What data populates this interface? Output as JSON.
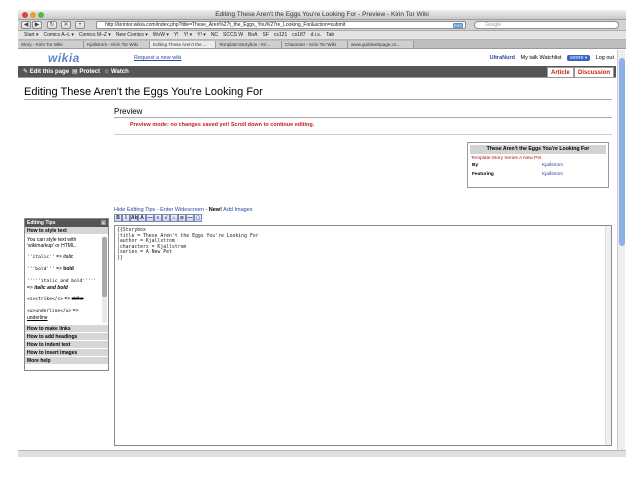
{
  "browser": {
    "window_title": "Editing These Aren't the Eggs You're Looking For - Preview - Kirin Tor Wiki",
    "url": "http://kirintor.wikia.com/index.php?title=These_Aren%27t_the_Eggs_You%27re_Looking_For&action=submit",
    "rss_label": "RSS",
    "search_placeholder": "Google",
    "bookmarks": [
      "Start ▾",
      "Comics A–L ▾",
      "Comics M–Z ▾",
      "New Comics ▾",
      "WoW ▾",
      "Y!",
      "Y! ▾",
      "Y! ▾",
      "NC",
      "SCCS W",
      "BoA",
      "SF",
      "cs121",
      "cs187",
      "d.i.s.",
      "Tab"
    ],
    "tabs": [
      {
        "label": "Story - Kirin Tor Wiki"
      },
      {
        "label": "Kjallstrom - Kirin Tor Wiki"
      },
      {
        "label": "Editing These Aren't the ..."
      },
      {
        "label": "Template:Storybox - Kir..."
      },
      {
        "label": "Character - Kirin Tor Wiki"
      },
      {
        "label": "www.guildwebpage.co..."
      }
    ]
  },
  "header": {
    "logo": "wikia",
    "request_link": "Request a new wiki",
    "username": "UltraNurd",
    "my_talk": "My talk",
    "watchlist": "Watchlist",
    "more": "MORE ▾",
    "logout": "Log out"
  },
  "actions": {
    "edit": "Edit this page",
    "protect": "Protect",
    "watch": "Watch",
    "article_tab": "Article",
    "discussion_tab": "Discussion"
  },
  "page": {
    "title": "Editing These Aren't the Eggs You're Looking For",
    "preview_heading": "Preview",
    "preview_message": "Preview mode: no changes saved yet! Scroll down to continue editing."
  },
  "infobox": {
    "title": "These Aren't the Eggs You're Looking For",
    "series_link": "Template:Story Series A New Pet",
    "rows": [
      {
        "key": "By",
        "value": "Kjallstrom"
      },
      {
        "key": "Featuring",
        "value": "Kjallstrom"
      }
    ]
  },
  "editor": {
    "tips_link": "Hide Editing Tips - Enter Widescreen",
    "new_label": "New!",
    "add_images": "Add Images",
    "toolbar": [
      "B",
      "I",
      "Ab",
      "A",
      "—",
      "≡",
      "√",
      "⌂",
      "⊘",
      "—",
      "▢"
    ],
    "lines": [
      "{{Storybox",
      "|title = These Aren't the Eggs You're Looking For",
      "|author = Kjallstrom",
      "|characters = Kjallstrom",
      "|series = A New Pet",
      "}}"
    ]
  },
  "tips": {
    "title": "Editing Tips",
    "close": "x",
    "active_section": "How to style text",
    "intro": "You can style text with 'wikimarkup' or HTML.",
    "examples": [
      {
        "code": "''italic''",
        "arrow": "=>",
        "result": "italic"
      },
      {
        "code": "'''bold'''",
        "arrow": "=>",
        "result": "bold"
      },
      {
        "code": "'''''italic and bold'''''",
        "arrow": "=>",
        "result": "italic and bold"
      },
      {
        "code": "<s>strike</s>",
        "arrow": "=>",
        "result": "strike"
      },
      {
        "code": "<u>underline</u>",
        "arrow": "=>",
        "result": "underline"
      }
    ],
    "sections": [
      "How to make links",
      "How to add headings",
      "How to indent text",
      "How to insert images",
      "More help"
    ]
  }
}
